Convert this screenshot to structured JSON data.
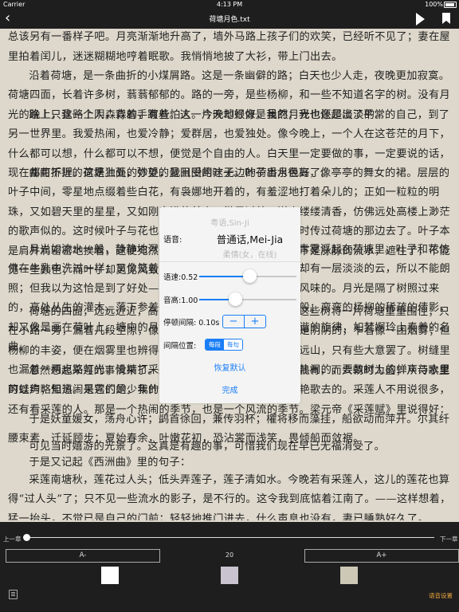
{
  "status": {
    "carrier": "Carrier",
    "time": "4:13 PM",
    "battery": "100%"
  },
  "nav": {
    "back_glyph": "‹",
    "title": "荷塘月色.txt"
  },
  "content": {
    "paragraphs": [
      "这几天心里颇不宁静。今晚在院子里坐着乘凉，忽然想起日日走过的荷塘，在这满月的光里，总该另有一番样子吧。月亮渐渐地升高了，墙外马路上孩子们的欢笑，已经听不见了；妻在屋里拍着闰儿，迷迷糊糊地哼着眠歌。我悄悄地披了大衫，带上门出去。",
      "沿着荷塘，是一条曲折的小煤屑路。这是一条幽僻的路；白天也少人走，夜晚更加寂寞。荷塘四面，长着许多树，蓊蓊郁郁的。路的一旁，是些杨柳，和一些不知道名字的树。没有月光的晚上，这路上阴森森的，有些怕人。今晚却很好，虽然月光也还是淡淡的。",
      "路上只我一个人，背着手踱着。这一片天地好像是我的；我也像超出了平常的自己，到了另一世界里。我爱热闹，也爱冷静；爱群居，也爱独处。像今晚上，一个人在这苍茫的月下，什么都可以想，什么都可以不想，便觉是个自由的人。白天里一定要做的事，一定要说的话，现在都可不理。这是独处的妙处，我且受用这无边的荷香月色好了。",
      "曲曲折折的荷塘上面，弥望的是田田的叶子。叶子出水很高，像亭亭的舞女的裙。层层的叶子中间，零星地点缀着些白花，有袅娜地开着的，有羞涩地打着朵儿的；正如一粒粒的明珠，又如碧天里的星星，又如刚出浴的美人。微风过处，送来缕缕清香，仿佛远处高楼上渺茫的歌声似的。这时候叶子与花也有一丝的颤动，像闪电般，霎时传过荷塘的那边去了。叶子本是肩并肩密密地挨着，这便宛然有了一道凝碧的波痕。叶子底下是脉脉的流水，遮住了，不能见一些颜色；而叶子却更见风致了。",
      "月光如流水一般，静静地泻在这一片叶子和花上。薄薄的青雾浮起在荷塘里。叶子和花仿佛在牛乳中洗过一样；又像笼着轻纱的梦。虽然是满月，天上却有一层淡淡的云，所以不能朗照；但我以为这恰是到了好处——酣眠固不可少，小睡也别有风味的。月光是隔了树照过来的，高处丛生的灌木，落下参差的斑驳的黑影，峭楞楞如鬼一般；弯弯的杨柳的稀疏的倩影，却又像是画在荷叶上。塘中的月色并不均匀；但光与影有着和谐的旋律，如梵婀玲上奏着的名曲。",
      "荷塘的四面，远远近近，高高低低都是树，而杨柳最多。这些树将一片荷塘重重围住；只在小路一旁，漏着几段空隙，像是特为月光留下的。树色一例是阴阴的，乍看像一团烟雾；但杨柳的丰姿，便在烟雾里也辨得出。树梢上隐隐约约的是一带远山，只有些大意罢了。树缝里也漏着一两点路灯光，没精打采的，是渴睡人的眼。这时候最热闹的，要数树上的蝉声与水里的蛙声；但热闹是它们的，我什么也没有。",
      "忽然想起采莲的事情来了。采莲是江南的旧俗，似乎很早就有，而六朝时为盛；从诗歌里可以约略知道。采莲的是少年的女子，她们是荡着小船，唱着艳歌去的。采莲人不用说很多，还有看采莲的人。那是一个热闹的季节，也是一个风流的季节。梁元帝《采莲赋》里说得好：",
      "于是妖童媛女，荡舟心许；鹢首徐回，兼传羽杯；欋将移而藻挂，船欲动而萍开。尔其纤腰束素，迁延顾步；夏始春余，叶嫩花初，恐沾裳而浅笑，畏倾船而敛裾。",
      "可见当时嬉游的光景了。这真是有趣的事，可惜我们现在早已无福消受了。",
      "于是又记起《西洲曲》里的句子：",
      "采莲南塘秋，莲花过人头；低头弄莲子，莲子清如水。今晚若有采莲人，这儿的莲花也算得“过人头”了；只不见一些流水的影子，是不行的。这令我到底惦着江南了。——这样想着，猛一抬头，不觉已是自己的门前；轻轻地推门进去，什么声息也没有，妻已睡熟好久了。"
    ]
  },
  "tts_dialog": {
    "title": "粤语,Sin-Ji",
    "voice_label": "语音:",
    "voice_selected": "普通话,Mei-Jia",
    "voice_next": "柔情(女，在线)",
    "rate_label": "语速:0.52",
    "rate_value": 0.52,
    "pitch_label": "音高:1.00",
    "pitch_value": 0.37,
    "pause_label": "停顿间隔: 0.10s",
    "stepper_minus": "−",
    "stepper_plus": "+",
    "interval_label": "间隔位置:",
    "seg_paragraph": "每段",
    "seg_sentence": "每句",
    "reset_label": "恢复默认",
    "done_label": "完成"
  },
  "bottom_bar": {
    "prev_chapter": "上一章",
    "next_chapter": "下一章",
    "progress": 0.0,
    "font_decrease": "A-",
    "font_size": "20",
    "font_increase": "A+",
    "themes": [
      "#ffffff",
      "#c9c3cf",
      "#cdc7b6"
    ],
    "voice_settings": "语音设置"
  },
  "colors": {
    "accent": "#1a7ef7",
    "page_bg": "#ddd8cb",
    "bar_bg": "#1e1e1e",
    "voice_settings": "#e8a33c"
  }
}
